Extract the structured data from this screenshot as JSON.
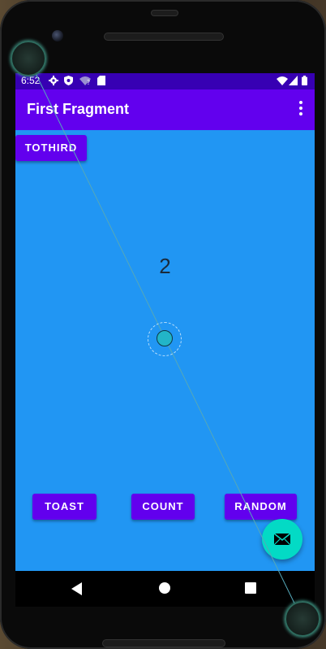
{
  "statusbar": {
    "time": "6:52",
    "left_icons": [
      "gear-icon",
      "shield-icon",
      "wifi-question-icon",
      "sd-card-icon"
    ],
    "right_icons": [
      "wifi-icon",
      "signal-icon",
      "battery-icon"
    ]
  },
  "appbar": {
    "title": "First Fragment",
    "menu_icon": "more-vert-icon"
  },
  "buttons": {
    "tothird": "TOTHIRD",
    "toast": "TOAST",
    "count": "COUNT",
    "random": "RANDOM"
  },
  "counter_value": "2",
  "fab": {
    "icon": "mail-icon"
  },
  "navbar": {
    "icons": [
      "back-icon",
      "home-icon",
      "recents-icon"
    ]
  },
  "colors": {
    "status_bar": "#3700b3",
    "app_bar": "#6200ee",
    "background": "#2196f3",
    "button": "#6200ee",
    "fab": "#03dac5"
  }
}
